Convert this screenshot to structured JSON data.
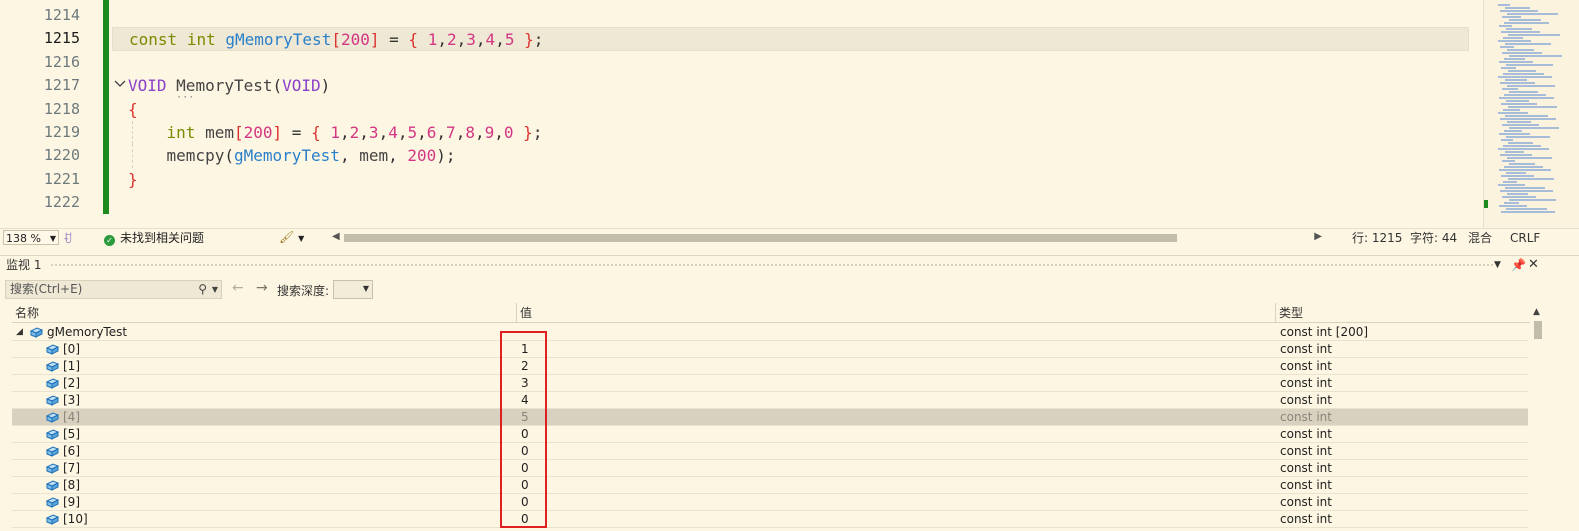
{
  "editor": {
    "lines": [
      {
        "num": "1214",
        "current": false
      },
      {
        "num": "1215",
        "current": true
      },
      {
        "num": "1216",
        "current": false
      },
      {
        "num": "1217",
        "current": false
      },
      {
        "num": "1218",
        "current": false
      },
      {
        "num": "1219",
        "current": false
      },
      {
        "num": "1220",
        "current": false
      },
      {
        "num": "1221",
        "current": false
      },
      {
        "num": "1222",
        "current": false
      }
    ],
    "code": {
      "l1215": {
        "kw1": "const",
        "kw2": "int",
        "ident": "gMemoryTest",
        "lb": "[",
        "size": "200",
        "rb": "]",
        "eq": " = ",
        "lbrace": "{",
        "v1": "1",
        "v2": "2",
        "v3": "3",
        "v4": "4",
        "v5": "5",
        "rbrace": "}",
        "end": ";"
      },
      "l1217": {
        "ty": "VOID",
        "fn": "MemoryTest",
        "lp": "(",
        "arg": "VOID",
        "rp": ")"
      },
      "l1218": {
        "brace": "{"
      },
      "l1219": {
        "kw": "int",
        "name": "mem",
        "lb": "[",
        "size": "200",
        "rb": "]",
        "eq": " = ",
        "lbrace": "{",
        "vals": [
          "1",
          "2",
          "3",
          "4",
          "5",
          "6",
          "7",
          "8",
          "9",
          "0"
        ],
        "rbrace": "}",
        "end": ";"
      },
      "l1220": {
        "fn": "memcpy",
        "lp": "(",
        "a1": "gMemoryTest",
        "sep1": ", ",
        "a2": "mem",
        "sep2": ", ",
        "a3": "200",
        "rp": ")",
        "end": ";"
      },
      "l1221": {
        "brace": "}"
      }
    },
    "fold_icon": "chevron-down-icon",
    "fold_dots": "···"
  },
  "status": {
    "zoom": "138 %",
    "issues": "未找到相关问题",
    "line": "行: 1215",
    "char": "字符: 44",
    "mode": "混合",
    "eol": "CRLF"
  },
  "watch": {
    "title": "监视 1",
    "search_placeholder": "搜索(Ctrl+E)",
    "depth_label": "搜索深度:",
    "columns": {
      "name": "名称",
      "value": "值",
      "type": "类型"
    },
    "root": {
      "name": "gMemoryTest",
      "value": "",
      "type": "const int [200]"
    },
    "items": [
      {
        "name": "[0]",
        "value": "1",
        "type": "const int"
      },
      {
        "name": "[1]",
        "value": "2",
        "type": "const int"
      },
      {
        "name": "[2]",
        "value": "3",
        "type": "const int"
      },
      {
        "name": "[3]",
        "value": "4",
        "type": "const int"
      },
      {
        "name": "[4]",
        "value": "5",
        "type": "const int",
        "selected": true
      },
      {
        "name": "[5]",
        "value": "0",
        "type": "const int"
      },
      {
        "name": "[6]",
        "value": "0",
        "type": "const int"
      },
      {
        "name": "[7]",
        "value": "0",
        "type": "const int"
      },
      {
        "name": "[8]",
        "value": "0",
        "type": "const int"
      },
      {
        "name": "[9]",
        "value": "0",
        "type": "const int"
      },
      {
        "name": "[10]",
        "value": "0",
        "type": "const int"
      }
    ]
  },
  "colors": {
    "accent_highlight": "#e02020",
    "change_bar": "#1d8a1d",
    "background": "#fdf6e3"
  }
}
